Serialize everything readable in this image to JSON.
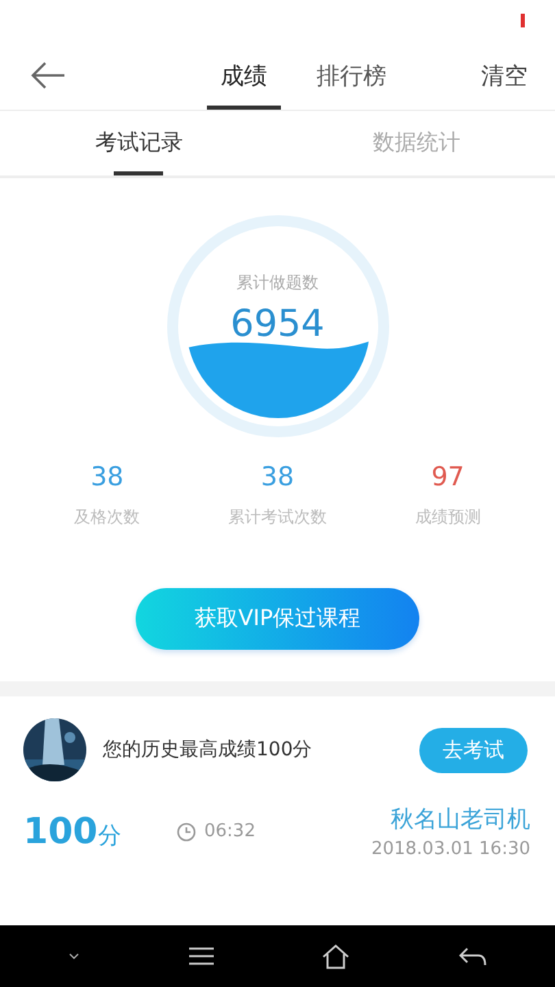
{
  "header": {
    "tabs": [
      {
        "label": "成绩",
        "selected": true
      },
      {
        "label": "排行榜",
        "selected": false
      }
    ],
    "action": "清空"
  },
  "subtabs": [
    {
      "label": "考试记录",
      "selected": true
    },
    {
      "label": "数据统计",
      "selected": false
    }
  ],
  "summary": {
    "caption": "累计做题数",
    "total": "6954"
  },
  "stats": [
    {
      "value": "38",
      "label": "及格次数",
      "kind": "normal"
    },
    {
      "value": "38",
      "label": "累计考试次数",
      "kind": "normal"
    },
    {
      "value": "97",
      "label": "成绩预测",
      "kind": "alert"
    }
  ],
  "vip_button": "获取VIP保过课程",
  "best": {
    "text": "您的历史最高成绩100分",
    "button": "去考试"
  },
  "records": [
    {
      "score": "100",
      "unit": "分",
      "duration": "06:32",
      "title": "秋名山老司机",
      "date": "2018.03.01  16:30"
    }
  ]
}
